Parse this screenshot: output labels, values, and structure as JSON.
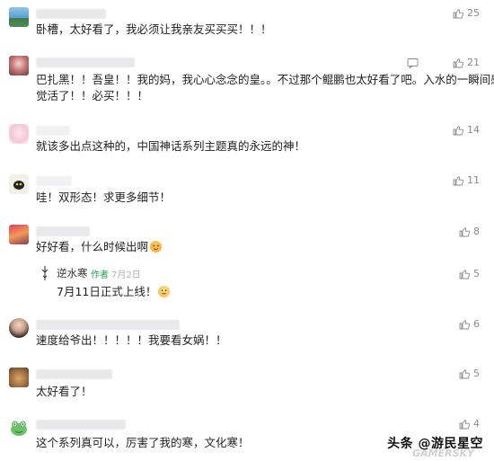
{
  "comments": [
    {
      "text_lines": [
        "卧槽，太好看了，我必须让我亲友买买买！！！"
      ],
      "likes": "25"
    },
    {
      "text_lines": [
        "巴扎黑！！吾皇！！我的妈，我心心念念的皇。。不过那个鲲鹏也太好看了吧。入水的一瞬间感",
        "觉活了！！必买！！！"
      ],
      "likes": "21"
    },
    {
      "text_lines": [
        "就该多出点这种的，中国神话系列主题真的永远的神！"
      ],
      "likes": "14"
    },
    {
      "text_lines": [
        "哇！双形态！求更多细节！"
      ],
      "likes": "11"
    },
    {
      "text_lines": [
        "好好看，什么时候出啊"
      ],
      "likes": "8"
    },
    {
      "text_lines": [
        "速度给爷出！！！！！我要看女娲！！"
      ],
      "likes": "6"
    },
    {
      "text_lines": [
        "太好看了！"
      ],
      "likes": "5"
    },
    {
      "text_lines": [
        "这个系列真可以，厉害了我的寒，文化寒！"
      ],
      "likes": "4"
    }
  ],
  "reply": {
    "name": "逆水寒",
    "author_tag": "作者",
    "date": "7月2日",
    "text": "7月11日正式上线！",
    "likes": "5"
  },
  "watermark": {
    "main": "头条 @游民星空",
    "sub": "GAMERSKY"
  },
  "colors": {
    "author_green": "#1aa34a",
    "like_gray": "#8a8a8a"
  }
}
